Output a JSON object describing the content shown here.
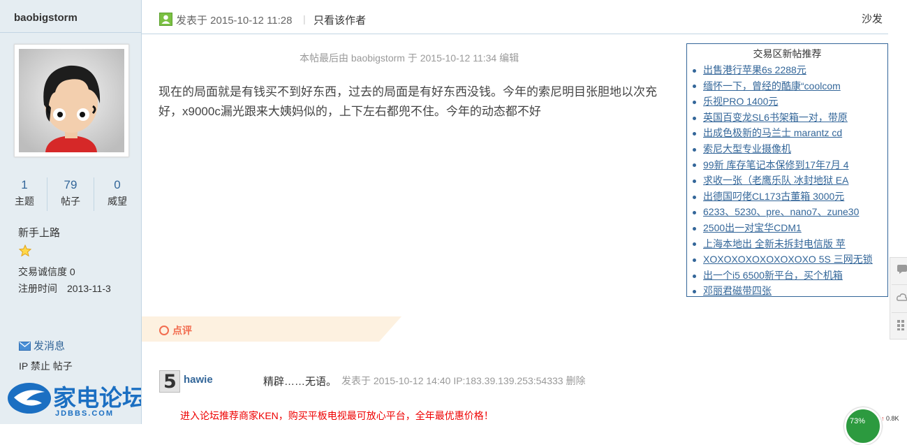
{
  "author": {
    "name": "baobigstorm",
    "stats": [
      {
        "value": "1",
        "label": "主题"
      },
      {
        "value": "79",
        "label": "帖子"
      },
      {
        "value": "0",
        "label": "威望"
      }
    ],
    "group": "新手上路",
    "star_icon": "star-icon",
    "credit_label": "交易诚信度 0",
    "reg_label": "注册时间",
    "reg_date": "2013-11-3",
    "send_message": "发消息",
    "admin_links": "IP 禁止 帖子"
  },
  "site_logo": {
    "cn": "家电论坛",
    "en": "JDBBS.COM"
  },
  "post": {
    "posted_at": "发表于 2015-10-12 11:28",
    "separator": "|",
    "only_author": "只看该作者",
    "floor": "沙发",
    "edit_note": "本帖最后由 baobigstorm 于 2015-10-12 11:34 编辑",
    "body": "现在的局面就是有钱买不到好东西，过去的局面是有好东西没钱。今年的索尼明目张胆地以次充好，x9000c漏光跟来大姨妈似的，上下左右都兜不住。今年的动态都不好"
  },
  "recommend": {
    "title": "交易区新帖推荐",
    "items": [
      "出售港行苹果6s 2288元",
      "缅怀一下，曾经的酷康“coolcom",
      "乐视PRO 1400元",
      "英国百变龙SL6书架箱一对，带原",
      "出成色极新的马兰士 marantz cd",
      "索尼大型专业摄像机",
      "99新 库存笔记本保修到17年7月 4",
      "求收一张（老鹰乐队 冰封地狱 EA",
      "出德国叼佬CL173古董箱 3000元",
      "6233、5230、pre、nano7、zune30",
      "2500出一对宝华CDM1",
      "上海本地出 全新未拆封电信版 苹",
      "XOXOXOXOXOXOXOXO 5S 三网无锁",
      "出一个i5 6500新平台，买个机箱",
      "邓丽君磁带四张"
    ]
  },
  "comments_tab": {
    "label": "点评"
  },
  "comment": {
    "avatar_text": "5",
    "user": "hawie",
    "text": "精辟……无语。",
    "meta": "发表于 2015-10-12 14:40 IP:183.39.139.253:54333 删除"
  },
  "ad_text": "进入论坛推荐商家KEN，购买平板电视最可放心平台，全年最优惠价格！",
  "net_monitor": {
    "percent": "73%",
    "speed": "0.8K",
    "percent_value": 73
  },
  "colors": {
    "link": "#336699",
    "sidebar_bg": "#e5edf2",
    "accent": "#f26c4f",
    "ad": "#ee0000"
  }
}
